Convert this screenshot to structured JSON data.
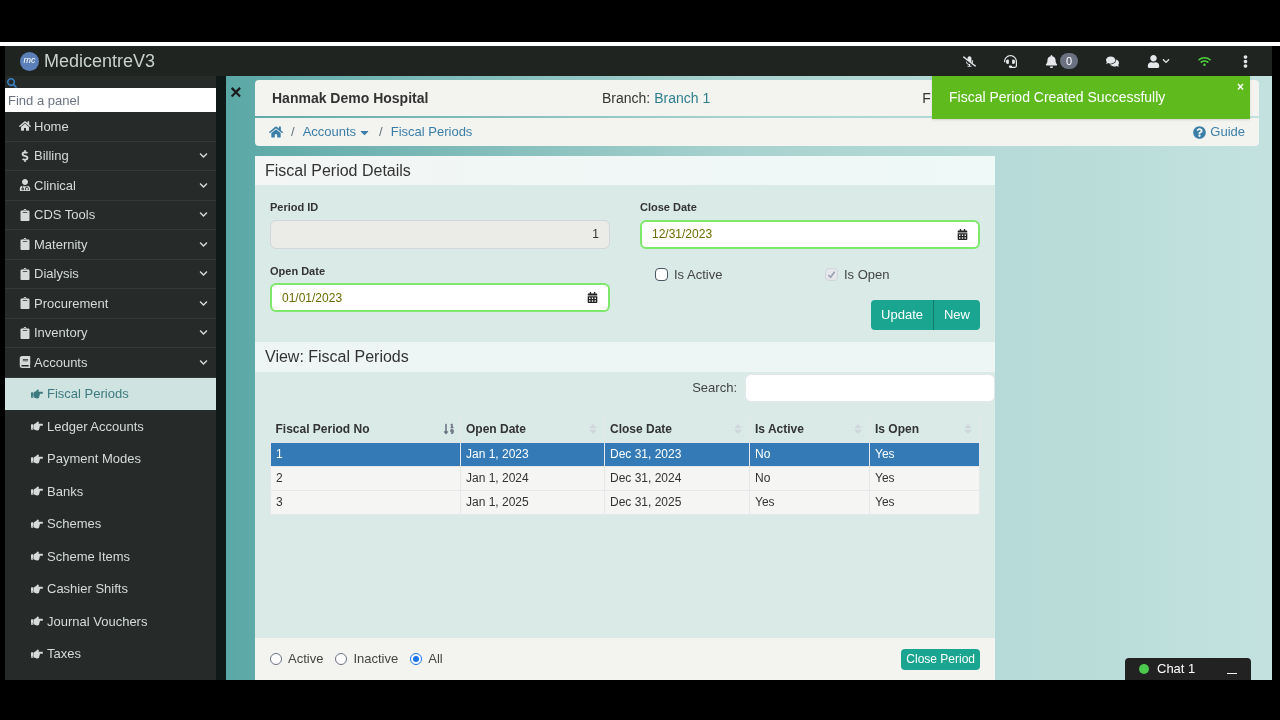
{
  "app": {
    "title": "MedicentreV3",
    "logo": "mc"
  },
  "topbar": {
    "notification_count": "0"
  },
  "toast": {
    "message": "Fiscal Period Created Successfully",
    "close": "×"
  },
  "sidebar": {
    "search": {
      "placeholder": "Find a panel"
    },
    "items": [
      {
        "label": "Home",
        "kind": "home",
        "expandable": false,
        "selected": false
      },
      {
        "label": "Billing",
        "kind": "dollar",
        "expandable": true,
        "selected": false
      },
      {
        "label": "Clinical",
        "kind": "user",
        "expandable": true,
        "selected": false
      },
      {
        "label": "CDS Tools",
        "kind": "clipboard",
        "expandable": true,
        "selected": false
      },
      {
        "label": "Maternity",
        "kind": "clipboard",
        "expandable": true,
        "selected": false
      },
      {
        "label": "Dialysis",
        "kind": "clipboard",
        "expandable": true,
        "selected": false
      },
      {
        "label": "Procurement",
        "kind": "clipboard",
        "expandable": true,
        "selected": false
      },
      {
        "label": "Inventory",
        "kind": "clipboard",
        "expandable": true,
        "selected": false
      },
      {
        "label": "Accounts",
        "kind": "book",
        "expandable": true,
        "selected": false,
        "children": [
          {
            "label": "Fiscal Periods",
            "selected": true
          },
          {
            "label": "Ledger Accounts",
            "selected": false
          },
          {
            "label": "Payment Modes",
            "selected": false
          },
          {
            "label": "Banks",
            "selected": false
          },
          {
            "label": "Schemes",
            "selected": false
          },
          {
            "label": "Scheme Items",
            "selected": false
          },
          {
            "label": "Cashier Shifts",
            "selected": false
          },
          {
            "label": "Journal Vouchers",
            "selected": false
          },
          {
            "label": "Taxes",
            "selected": false
          }
        ]
      }
    ]
  },
  "header": {
    "close": "×",
    "hospital": "Hanmak Demo Hospital",
    "branch_label": "Branch:",
    "branch": "Branch 1",
    "cut_text": "F"
  },
  "breadcrumb": {
    "items": [
      "Accounts",
      "Fiscal Periods"
    ],
    "separator": "/",
    "guide": "Guide"
  },
  "form": {
    "title": "Fiscal Period Details",
    "period_id": {
      "label": "Period ID",
      "value": "1"
    },
    "open_date": {
      "label": "Open Date",
      "value": "01/01/2023"
    },
    "close_date": {
      "label": "Close Date",
      "value": "12/31/2023"
    },
    "is_active": {
      "label": "Is Active",
      "checked": false,
      "disabled": false
    },
    "is_open": {
      "label": "Is Open",
      "checked": true,
      "disabled": true
    },
    "buttons": [
      "Update",
      "New"
    ]
  },
  "view": {
    "title": "View: Fiscal Periods",
    "search_label": "Search:",
    "table": {
      "columns": [
        "Fiscal Period No",
        "Open Date",
        "Close Date",
        "Is Active",
        "Is Open"
      ],
      "rows": [
        {
          "cells": [
            "1",
            "Jan 1, 2023",
            "Dec 31, 2023",
            "No",
            "Yes"
          ],
          "selected": true
        },
        {
          "cells": [
            "2",
            "Jan 1, 2024",
            "Dec 31, 2024",
            "No",
            "Yes"
          ],
          "selected": false
        },
        {
          "cells": [
            "3",
            "Jan 1, 2025",
            "Dec 31, 2025",
            "Yes",
            "Yes"
          ],
          "selected": false
        }
      ]
    },
    "filters": [
      {
        "label": "Active",
        "selected": false
      },
      {
        "label": "Inactive",
        "selected": false
      },
      {
        "label": "All",
        "selected": true
      }
    ],
    "close_button": "Close Period"
  },
  "chat": {
    "label": "Chat 1"
  }
}
